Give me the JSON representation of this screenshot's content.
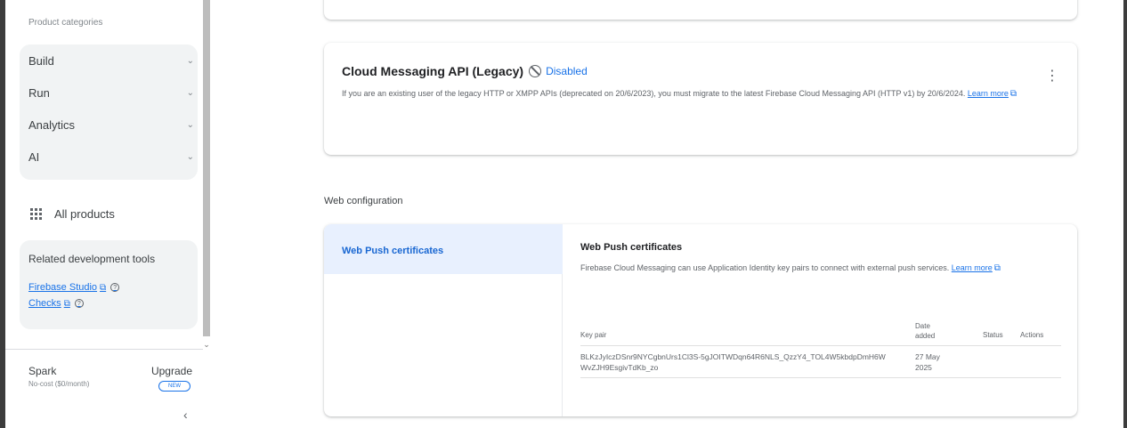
{
  "sidebar": {
    "categories_label": "Product categories",
    "categories": [
      {
        "label": "Build"
      },
      {
        "label": "Run"
      },
      {
        "label": "Analytics"
      },
      {
        "label": "AI"
      }
    ],
    "all_products": "All products",
    "related_title": "Related development tools",
    "related_links": [
      {
        "label": "Firebase Studio"
      },
      {
        "label": "Checks"
      }
    ],
    "plan": {
      "name": "Spark",
      "cost": "No-cost ($0/month)",
      "upgrade": "Upgrade",
      "badge": "NEW"
    }
  },
  "fcm": {
    "title": "Cloud Messaging API (Legacy)",
    "status": "Disabled",
    "desc": "If you are an existing user of the legacy HTTP or XMPP APIs (deprecated on 20/6/2023), you must migrate to the latest Firebase Cloud Messaging API (HTTP v1) by 20/6/2024.",
    "learn_more": "Learn more"
  },
  "web_config": {
    "section_label": "Web configuration",
    "tab": "Web Push certificates",
    "title": "Web Push certificates",
    "desc": "Firebase Cloud Messaging can use Application Identity key pairs to connect with external push services.",
    "learn_more": "Learn more",
    "columns": {
      "key_pair": "Key pair",
      "date_added": "Date added",
      "status": "Status",
      "actions": "Actions"
    },
    "rows": [
      {
        "key_pair": "BLKzJyIczDSnr9NYCgbnUrs1Cl3S-5gJOITWDqn64R6NLS_QzzY4_TOL4W5kbdpDmH6WWvZJH9EsgivTdKb_zo",
        "date_added": "27 May 2025",
        "status": "",
        "actions": ""
      }
    ]
  }
}
